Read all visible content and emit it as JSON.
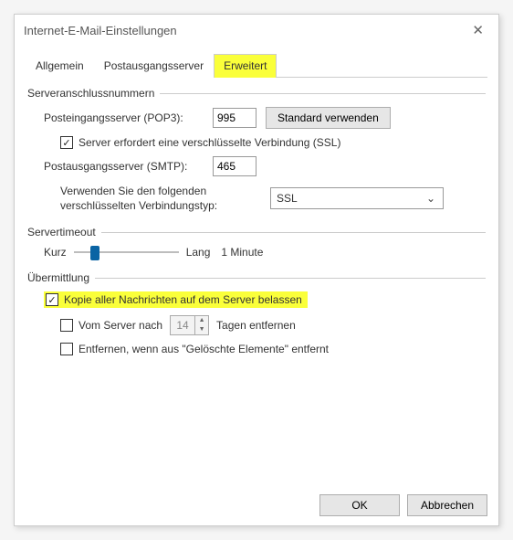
{
  "window": {
    "title": "Internet-E-Mail-Einstellungen"
  },
  "tabs": {
    "general": "Allgemein",
    "outgoing": "Postausgangsserver",
    "advanced": "Erweitert"
  },
  "ports": {
    "group": "Serveranschlussnummern",
    "pop3_label": "Posteingangsserver (POP3):",
    "pop3_value": "995",
    "default_btn": "Standard verwenden",
    "ssl_incoming": "Server erfordert eine verschlüsselte Verbindung (SSL)",
    "smtp_label": "Postausgangsserver (SMTP):",
    "smtp_value": "465",
    "enc_type_label": "Verwenden Sie den folgenden verschlüsselten Verbindungstyp:",
    "enc_type_value": "SSL"
  },
  "timeout": {
    "group": "Servertimeout",
    "short": "Kurz",
    "long": "Lang",
    "value": "1 Minute"
  },
  "delivery": {
    "group": "Übermittlung",
    "leave_copy": "Kopie aller Nachrichten auf dem Server belassen",
    "remove_after_pre": "Vom Server nach",
    "remove_after_days": "14",
    "remove_after_post": "Tagen entfernen",
    "remove_deleted": "Entfernen, wenn aus \"Gelöschte Elemente\" entfernt"
  },
  "buttons": {
    "ok": "OK",
    "cancel": "Abbrechen"
  }
}
